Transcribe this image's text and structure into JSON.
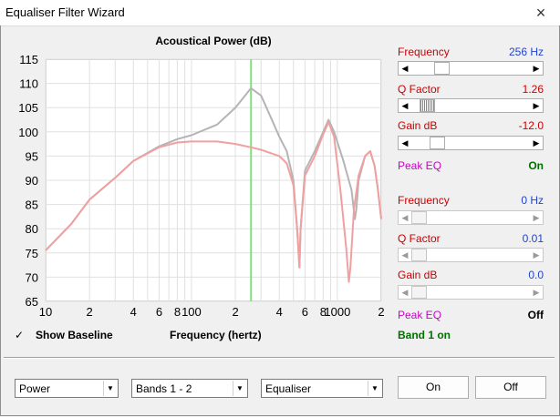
{
  "window": {
    "title": "Equaliser Filter Wizard",
    "close_glyph": "×"
  },
  "chart_data": {
    "type": "line",
    "title": "Acoustical Power (dB)",
    "xlabel": "Frequency (hertz)",
    "x_scale": "log",
    "xlim": [
      10,
      2000
    ],
    "ylim": [
      65,
      115
    ],
    "y_ticks": [
      115,
      110,
      105,
      100,
      95,
      90,
      85,
      80,
      75,
      70,
      65
    ],
    "x_tick_labels": [
      {
        "v": 10,
        "t": "10"
      },
      {
        "v": 20,
        "t": "2"
      },
      {
        "v": 40,
        "t": "4"
      },
      {
        "v": 60,
        "t": "6"
      },
      {
        "v": 80,
        "t": "8"
      },
      {
        "v": 100,
        "t": "100"
      },
      {
        "v": 200,
        "t": "2"
      },
      {
        "v": 400,
        "t": "4"
      },
      {
        "v": 600,
        "t": "6"
      },
      {
        "v": 800,
        "t": "8"
      },
      {
        "v": 1000,
        "t": "1000"
      },
      {
        "v": 2000,
        "t": "2"
      }
    ],
    "grid": true,
    "marker_line": {
      "x": 256,
      "color": "#80e080"
    },
    "series": [
      {
        "color": "#b4b4b4",
        "points": [
          [
            10,
            75.5
          ],
          [
            15,
            81
          ],
          [
            20,
            86
          ],
          [
            30,
            90.5
          ],
          [
            40,
            94
          ],
          [
            60,
            97
          ],
          [
            80,
            98.5
          ],
          [
            100,
            99.3
          ],
          [
            150,
            101.5
          ],
          [
            200,
            105
          ],
          [
            256,
            109
          ],
          [
            300,
            107.5
          ],
          [
            350,
            103
          ],
          [
            400,
            99
          ],
          [
            450,
            96
          ],
          [
            500,
            90
          ],
          [
            530,
            80
          ],
          [
            550,
            72
          ],
          [
            560,
            80
          ],
          [
            600,
            92
          ],
          [
            700,
            96
          ],
          [
            800,
            100
          ],
          [
            870,
            102.5
          ],
          [
            950,
            100
          ],
          [
            1100,
            94
          ],
          [
            1250,
            88
          ],
          [
            1320,
            82
          ],
          [
            1350,
            84
          ],
          [
            1400,
            90
          ],
          [
            1550,
            95
          ],
          [
            1680,
            96
          ],
          [
            1800,
            93
          ],
          [
            1900,
            88
          ],
          [
            2000,
            82
          ]
        ]
      },
      {
        "color": "#f0a0a0",
        "points": [
          [
            10,
            75.5
          ],
          [
            15,
            81
          ],
          [
            20,
            86
          ],
          [
            30,
            90.5
          ],
          [
            40,
            94
          ],
          [
            60,
            96.8
          ],
          [
            80,
            97.8
          ],
          [
            100,
            98
          ],
          [
            150,
            98
          ],
          [
            200,
            97.5
          ],
          [
            256,
            96.8
          ],
          [
            300,
            96.3
          ],
          [
            400,
            95
          ],
          [
            450,
            93.5
          ],
          [
            500,
            89
          ],
          [
            530,
            80
          ],
          [
            550,
            72
          ],
          [
            560,
            80
          ],
          [
            600,
            91
          ],
          [
            700,
            95
          ],
          [
            800,
            99.5
          ],
          [
            870,
            102
          ],
          [
            950,
            99
          ],
          [
            1050,
            88
          ],
          [
            1150,
            76
          ],
          [
            1200,
            69
          ],
          [
            1230,
            72
          ],
          [
            1300,
            84
          ],
          [
            1400,
            91
          ],
          [
            1550,
            95
          ],
          [
            1680,
            96
          ],
          [
            1800,
            93
          ],
          [
            1900,
            88
          ],
          [
            2000,
            82
          ]
        ]
      }
    ]
  },
  "show_baseline": {
    "label": "Show Baseline",
    "checked": true,
    "check_glyph": "✓"
  },
  "band1": {
    "frequency": {
      "label": "Frequency",
      "value": "256 Hz",
      "level": 0.22
    },
    "q_factor": {
      "label": "Q Factor",
      "value": "1.26",
      "level": 0.08
    },
    "gain": {
      "label": "Gain  dB",
      "value": "-12.0",
      "level": 0.18
    },
    "type_label": "Peak EQ",
    "state": "On"
  },
  "band2": {
    "frequency": {
      "label": "Frequency",
      "value": "0 Hz",
      "level": 0.0
    },
    "q_factor": {
      "label": "Q Factor",
      "value": "0.01",
      "level": 0.0
    },
    "gain": {
      "label": "Gain  dB",
      "value": "0.0",
      "level": 0.0
    },
    "type_label": "Peak EQ",
    "state": "Off"
  },
  "status": "Band 1 on",
  "footer": {
    "combo_power": "Power",
    "combo_bands": "Bands 1 - 2",
    "combo_mode": "Equaliser",
    "on_button": "On",
    "off_button": "Off"
  }
}
